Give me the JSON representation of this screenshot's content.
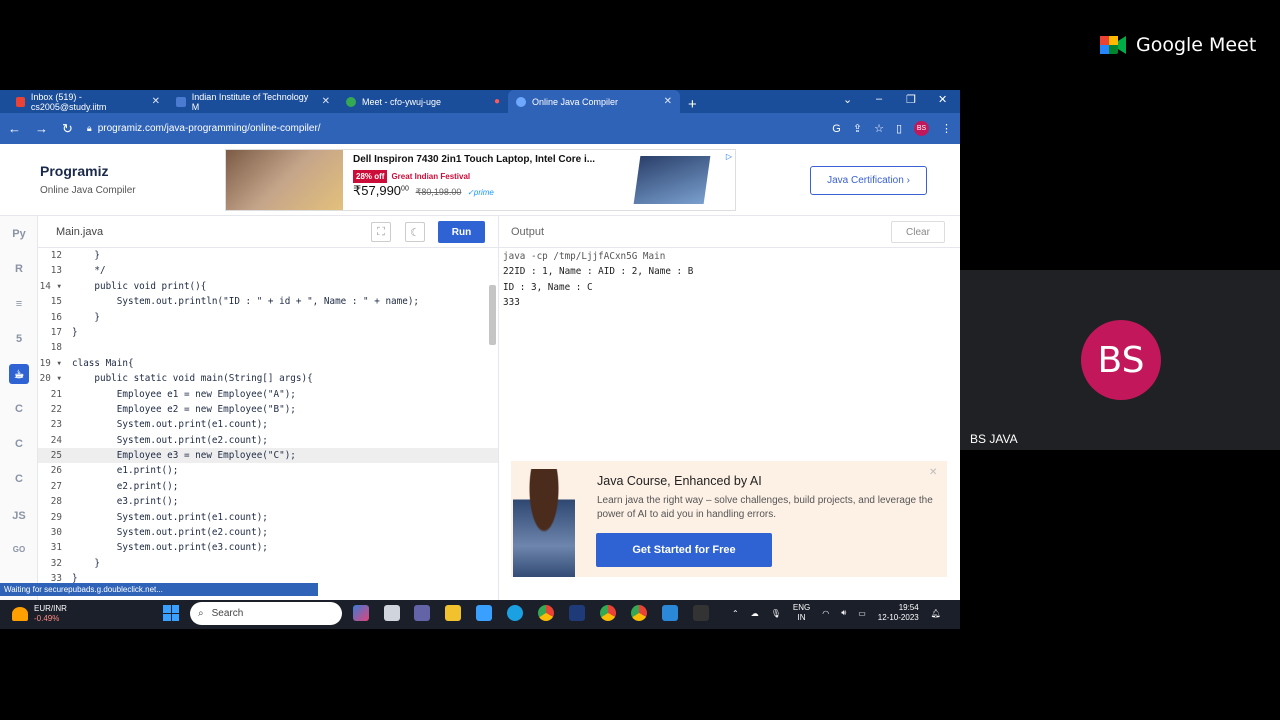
{
  "meet": {
    "app_name": "Google Meet",
    "participant_initials": "BS",
    "participant_name": "BS JAVA"
  },
  "browser": {
    "tabs": [
      {
        "label": "Inbox (519) - cs2005@study.iitm",
        "favicon": "gmail-icon",
        "color": "#ea4335"
      },
      {
        "label": "Indian Institute of Technology M",
        "favicon": "iitm-icon",
        "color": "#4a7bd0"
      },
      {
        "label": "Meet - cfo-ywuj-uge",
        "favicon": "meet-icon",
        "color": "#34a853"
      },
      {
        "label": "Online Java Compiler",
        "favicon": "programiz-icon",
        "color": "#6fa8ff"
      }
    ],
    "url": "programiz.com/java-programming/online-compiler/",
    "profile_initials": "BS"
  },
  "site": {
    "logo": "Programiz",
    "subtitle": "Online Java Compiler",
    "certification_button": "Java Certification ›",
    "ad": {
      "title": "Dell Inspiron 7430 2in1 Touch Laptop, Intel Core i...",
      "discount": "28% off",
      "festival": "Great Indian Festival",
      "price": "₹57,990",
      "price_sup": "00",
      "mrp": "₹80,198.00",
      "prime": "✓prime"
    }
  },
  "editor": {
    "file_tab": "Main.java",
    "run_label": "Run",
    "lines": [
      {
        "n": "12",
        "code": "    }"
      },
      {
        "n": "13",
        "code": "    */"
      },
      {
        "n": "14 ▾",
        "code": "    public void print(){"
      },
      {
        "n": "15",
        "code": "        System.out.println(\"ID : \" + id + \", Name : \" + name);"
      },
      {
        "n": "16",
        "code": "    }"
      },
      {
        "n": "17",
        "code": "}"
      },
      {
        "n": "18",
        "code": ""
      },
      {
        "n": "19 ▾",
        "code": "class Main{"
      },
      {
        "n": "20 ▾",
        "code": "    public static void main(String[] args){"
      },
      {
        "n": "21",
        "code": "        Employee e1 = new Employee(\"A\");"
      },
      {
        "n": "22",
        "code": "        Employee e2 = new Employee(\"B\");"
      },
      {
        "n": "23",
        "code": "        System.out.print(e1.count);"
      },
      {
        "n": "24",
        "code": "        System.out.print(e2.count);"
      },
      {
        "n": "25",
        "code": "        Employee e3 = new Employee(\"C\");",
        "highlight": true
      },
      {
        "n": "26",
        "code": "        e1.print();"
      },
      {
        "n": "27",
        "code": "        e2.print();"
      },
      {
        "n": "28",
        "code": "        e3.print();"
      },
      {
        "n": "29",
        "code": "        System.out.print(e1.count);"
      },
      {
        "n": "30",
        "code": "        System.out.print(e2.count);"
      },
      {
        "n": "31",
        "code": "        System.out.print(e3.count);"
      },
      {
        "n": "32",
        "code": "    }"
      },
      {
        "n": "33",
        "code": "}"
      }
    ],
    "status_text": "Waiting for securepubads.g.doubleclick.net..."
  },
  "output": {
    "label": "Output",
    "clear_label": "Clear",
    "lines": [
      "java -cp /tmp/LjjfACxn5G Main",
      "22ID : 1, Name : AID : 2, Name : B",
      "ID : 3, Name : C",
      "333"
    ]
  },
  "course_ad": {
    "title": "Java Course, Enhanced by AI",
    "description": "Learn java the right way – solve challenges, build projects, and leverage the power of AI to aid you in handling errors.",
    "button": "Get Started for Free"
  },
  "taskbar": {
    "ticker_name": "EUR/INR",
    "ticker_change": "-0.49%",
    "search_placeholder": "Search",
    "lang_top": "ENG",
    "lang_bottom": "IN",
    "time": "19:54",
    "date": "12-10-2023"
  }
}
